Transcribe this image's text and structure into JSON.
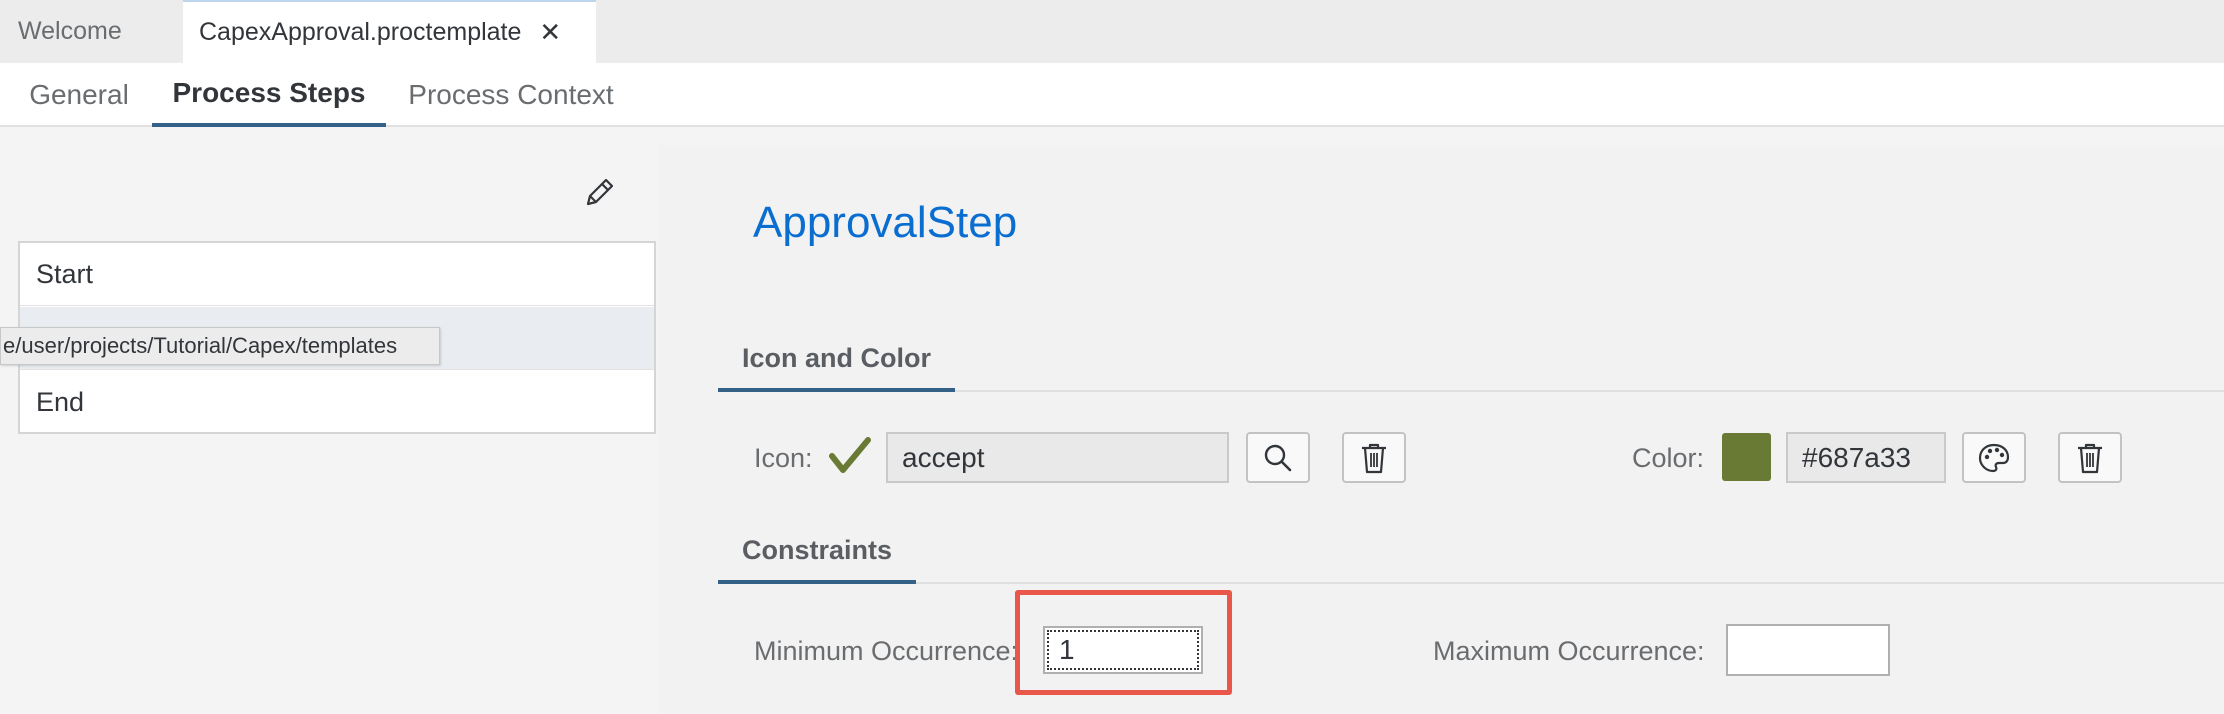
{
  "editor_tabs": {
    "welcome": "Welcome",
    "active": "CapexApproval.proctemplate",
    "close_glyph": "✕"
  },
  "sub_tabs": {
    "general": "General",
    "process_steps": "Process Steps",
    "process_context": "Process Context"
  },
  "steps": {
    "items": [
      {
        "label": "Start"
      },
      {
        "label": ""
      },
      {
        "label": "End"
      }
    ],
    "tooltip": "e/user/projects/Tutorial/Capex/templates"
  },
  "detail": {
    "title": "ApprovalStep",
    "icon_color_section": "Icon and Color",
    "icon_label": "Icon:",
    "icon_value": "accept",
    "color_label": "Color:",
    "color_value": "#687a33",
    "constraints_section": "Constraints",
    "min_label": "Minimum Occurrence:",
    "min_value": "1",
    "max_label": "Maximum Occurrence:",
    "max_value": ""
  },
  "icons": {
    "edit": "pencil-icon",
    "accept": "checkmark-icon",
    "search": "search-icon",
    "delete": "trash-icon",
    "palette": "palette-icon"
  },
  "colors": {
    "accent": "#346187",
    "title": "#0a6ed1",
    "swatch": "#687a33",
    "highlight": "#e8574a"
  }
}
